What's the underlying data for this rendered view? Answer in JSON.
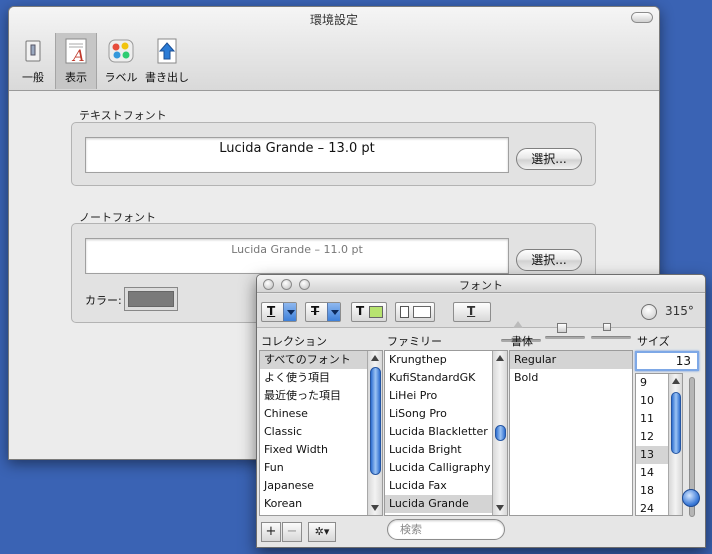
{
  "prefs": {
    "title": "環境設定",
    "toolbar": [
      {
        "label": "一般",
        "icon": "switch-icon"
      },
      {
        "label": "表示",
        "icon": "font-style-icon"
      },
      {
        "label": "ラベル",
        "icon": "color-labels-icon"
      },
      {
        "label": "書き出し",
        "icon": "export-arrow-icon"
      }
    ],
    "selected_tab": "表示",
    "text_font": {
      "section_label": "テキストフォント",
      "value": "Lucida Grande – 13.0 pt",
      "button": "選択..."
    },
    "note_font": {
      "section_label": "ノートフォント",
      "value": "Lucida Grande – 11.0 pt",
      "button": "選択...",
      "color_label": "カラー:",
      "color": "#7a7a7a"
    }
  },
  "font_panel": {
    "title": "フォント",
    "rotation": "315°",
    "columns": {
      "collection": "コレクション",
      "family": "ファミリー",
      "typeface": "書体",
      "size": "サイズ"
    },
    "collections": [
      "すべてのフォント",
      "よく使う項目",
      "最近使った項目",
      "Chinese",
      "Classic",
      "Fixed Width",
      "Fun",
      "Japanese",
      "Korean"
    ],
    "families": [
      "Krungthep",
      "KufiStandardGK",
      "LiHei Pro",
      "LiSong Pro",
      "Lucida Blackletter",
      "Lucida Bright",
      "Lucida Calligraphy",
      "Lucida Fax",
      "Lucida Grande"
    ],
    "typefaces": [
      "Regular",
      "Bold"
    ],
    "size_value": "13",
    "sizes": [
      "9",
      "10",
      "11",
      "12",
      "13",
      "14",
      "18",
      "24"
    ],
    "search_placeholder": "検索",
    "add_label": "+",
    "remove_label": "−",
    "action_label": "✲▾",
    "colors": {
      "accent": "#3d7fd9",
      "text_color_swatch": "#b7e36f"
    }
  }
}
